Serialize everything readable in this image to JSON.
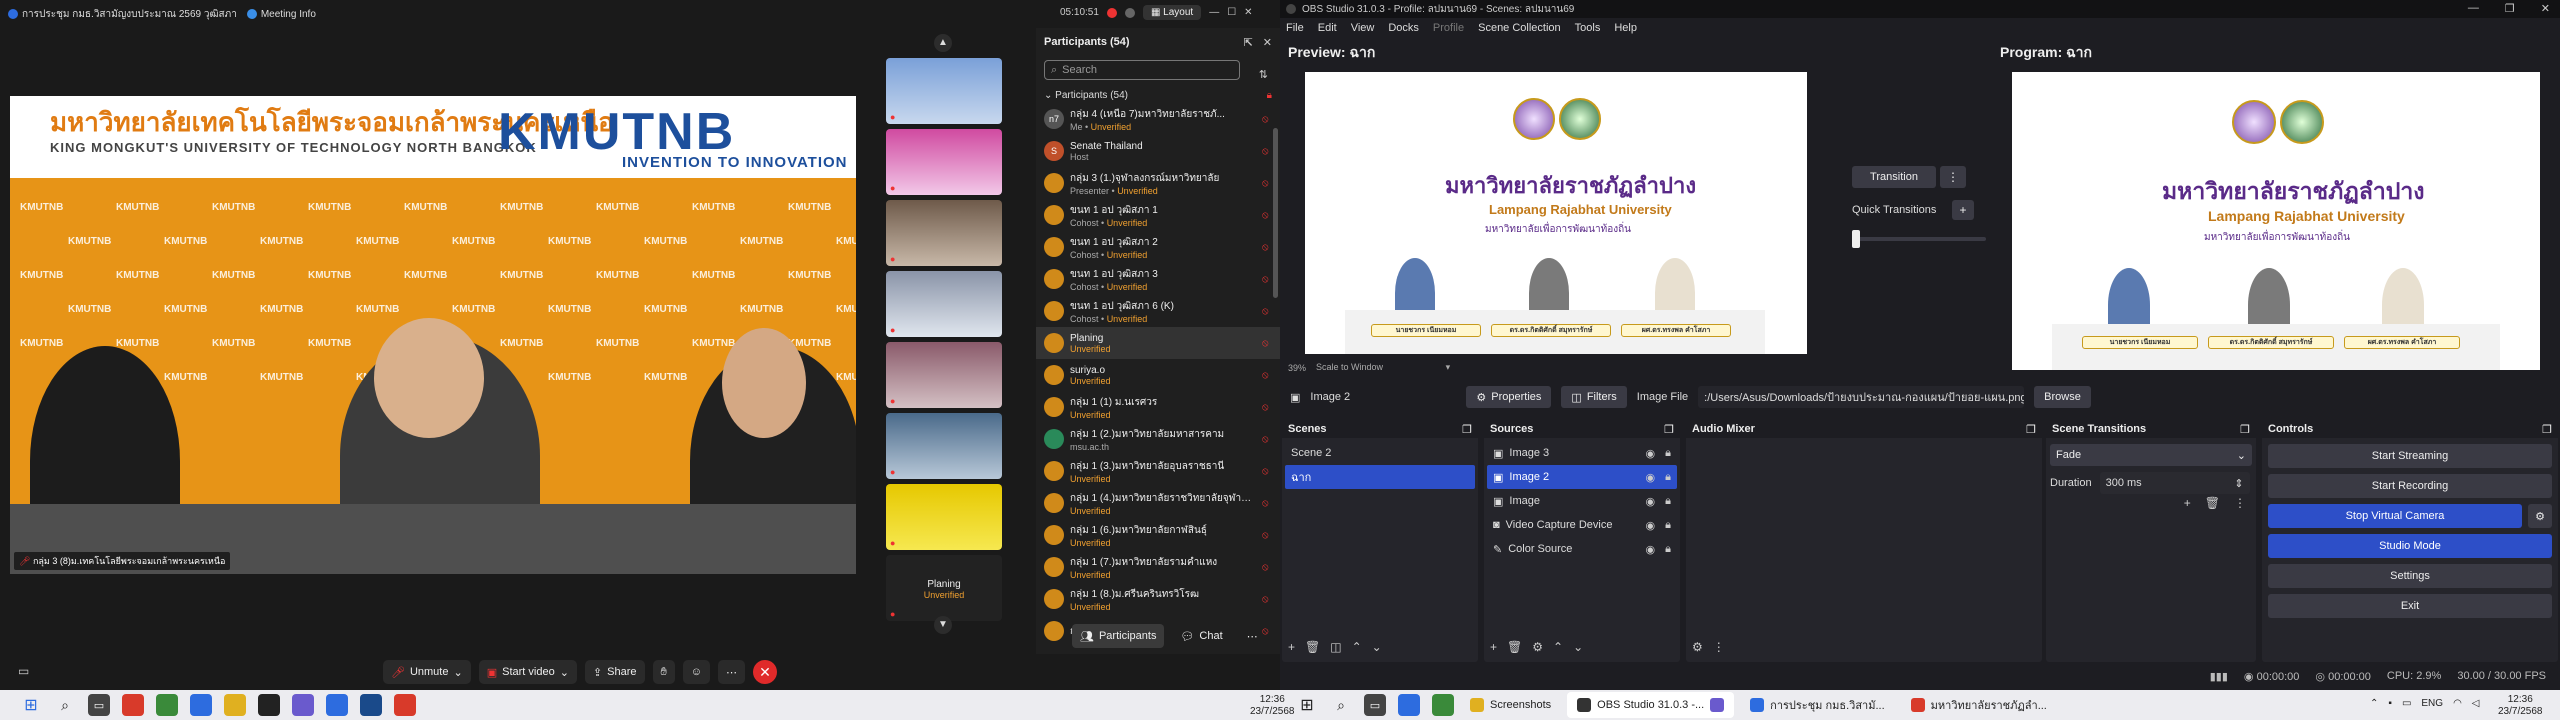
{
  "zoom": {
    "window_title": "การประชุม กมธ.วิสามัญงบประมาณ 2569 วุฒิสภา",
    "meeting_info": "Meeting Info",
    "timer": "05:10:51",
    "layout": "Layout",
    "speaker_label": "กลุ่ม 3 (8)ม.เทคโนโลยีพระจอมเกล้าพระนครเหนือ",
    "speaker_banner": {
      "thai": "มหาวิทยาลัยเทคโนโลยีพระจอมเกล้าพระนครเหนือ",
      "english": "KING MONGKUT'S UNIVERSITY OF TECHNOLOGY NORTH BANGKOK",
      "logo": "KMUTNB",
      "tagline": "INVENTION TO INNOVATION",
      "backdrop": "KMUTNB"
    },
    "thumb_planing": "Planing",
    "thumb_unverified": "Unverified",
    "toolbar": {
      "unmute": "Unmute",
      "start_video": "Start video",
      "share": "Share"
    },
    "participants": {
      "title": "Participants (54)",
      "search_placeholder": "Search",
      "section": "Participants (54)",
      "list": [
        {
          "initials": "n7",
          "name": "กลุ่ม 4 (เหนือ 7)มหาวิทยาลัยราชภั...",
          "role": "Me",
          "unverified": "Unverified",
          "color": "#555555"
        },
        {
          "initials": "S",
          "name": "Senate Thailand",
          "role": "Host",
          "unverified": "",
          "color": "#c0502a"
        },
        {
          "initials": "",
          "name": "กลุ่ม 3 (1.)จุฬาลงกรณ์มหาวิทยาลัย",
          "role": "Presenter",
          "unverified": "Unverified",
          "color": "#d08a1a"
        },
        {
          "initials": "",
          "name": "ขนท 1 อป วุฒิสภา 1",
          "role": "Cohost",
          "unverified": "Unverified",
          "color": "#d08a1a"
        },
        {
          "initials": "",
          "name": "ขนท 1 อป วุฒิสภา 2",
          "role": "Cohost",
          "unverified": "Unverified",
          "color": "#d08a1a"
        },
        {
          "initials": "",
          "name": "ขนท 1 อป วุฒิสภา 3",
          "role": "Cohost",
          "unverified": "Unverified",
          "color": "#d08a1a"
        },
        {
          "initials": "",
          "name": "ขนท 1 อป วุฒิสภา 6 (K)",
          "role": "Cohost",
          "unverified": "Unverified",
          "color": "#d08a1a"
        },
        {
          "initials": "",
          "name": "Planing",
          "role": "",
          "unverified": "Unverified",
          "color": "#d08a1a"
        },
        {
          "initials": "",
          "name": "suriya.o",
          "role": "",
          "unverified": "Unverified",
          "color": "#d08a1a"
        },
        {
          "initials": "",
          "name": "กลุ่ม 1 (1) ม.นเรศวร",
          "role": "",
          "unverified": "Unverified",
          "color": "#d08a1a"
        },
        {
          "initials": "",
          "name": "กลุ่ม 1 (2.)มหาวิทยาลัยมหาสารคาม",
          "role": "msu.ac.th",
          "unverified": "",
          "color": "#2a8a5a"
        },
        {
          "initials": "",
          "name": "กลุ่ม 1 (3.)มหาวิทยาลัยอุบลราชธานี",
          "role": "",
          "unverified": "Unverified",
          "color": "#d08a1a"
        },
        {
          "initials": "",
          "name": "กลุ่ม 1 (4.)มหาวิทยาลัยราชวิทยาลัยจุฬาภรณ์",
          "role": "",
          "unverified": "Unverified",
          "color": "#d08a1a"
        },
        {
          "initials": "",
          "name": "กลุ่ม 1 (6.)มหาวิทยาลัยกาฬสินธุ์",
          "role": "",
          "unverified": "Unverified",
          "color": "#d08a1a"
        },
        {
          "initials": "",
          "name": "กลุ่ม 1 (7.)มหาวิทยาลัยรามคำแหง",
          "role": "",
          "unverified": "Unverified",
          "color": "#d08a1a"
        },
        {
          "initials": "",
          "name": "กลุ่ม 1 (8.)ม.ศรีนครินทรวิโรฒ",
          "role": "",
          "unverified": "Unverified",
          "color": "#d08a1a"
        },
        {
          "initials": "",
          "name": "กลุ่ม 1 (9.)ม.ปทุมวัน",
          "role": "",
          "unverified": "",
          "color": "#d08a1a"
        }
      ],
      "footer_participants": "Participants",
      "footer_chat": "Chat"
    }
  },
  "obs": {
    "window_title": "OBS Studio 31.0.3 - Profile: ลปมนาน69 - Scenes: ลปมนาน69",
    "menu": [
      "File",
      "Edit",
      "View",
      "Docks",
      "Profile",
      "Scene Collection",
      "Tools",
      "Help"
    ],
    "preview_label": "Preview: ฉาก",
    "program_label": "Program: ฉาก",
    "zoom_percent": "39%",
    "zoom_mode": "Scale to Window",
    "transition": "Transition",
    "quick_transitions": "Quick Transitions",
    "canvas": {
      "thai": "มหาวิทยาลัยราชภัฏลำปาง",
      "english": "Lampang Rajabhat University",
      "subtitle": "มหาวิทยาลัยเพื่อการพัฒนาท้องถิ่น",
      "names": [
        "นายชวกร เนียมหอม",
        "ดร.ดร.กิตติศักดิ์ สมุทรารักษ์",
        "ผศ.ดร.ทรงพล คำโสภา"
      ]
    },
    "source_toolbar": {
      "selected": "Image 2",
      "properties": "Properties",
      "filters": "Filters",
      "image_file_label": "Image File",
      "image_file_value": ":/Users/Asus/Downloads/ป้ายงบประมาณ-กองแผน/ป้ายอย-แผน.png",
      "browse": "Browse"
    },
    "scenes": {
      "title": "Scenes",
      "items": [
        "Scene 2",
        "ฉาก"
      ],
      "selected": 1
    },
    "sources": {
      "title": "Sources",
      "items": [
        "Image 3",
        "Image 2",
        "Image",
        "Video Capture Device",
        "Color Source"
      ],
      "selected": 1
    },
    "audio_mixer": {
      "title": "Audio Mixer"
    },
    "scene_transitions": {
      "title": "Scene Transitions",
      "type": "Fade",
      "duration_label": "Duration",
      "duration": "300 ms"
    },
    "controls": {
      "title": "Controls",
      "start_streaming": "Start Streaming",
      "start_recording": "Start Recording",
      "stop_virtual_camera": "Stop Virtual Camera",
      "studio_mode": "Studio Mode",
      "settings": "Settings",
      "exit": "Exit"
    },
    "status": {
      "rec_time": "00:00:00",
      "stream_time": "00:00:00",
      "cpu": "CPU: 2.9%",
      "fps": "30.00 / 30.00 FPS"
    }
  },
  "taskbar": {
    "apps": [
      {
        "label": "Screenshots",
        "color": "#e0b020"
      },
      {
        "label": "OBS Studio 31.0.3 -...",
        "color": "#333333"
      },
      {
        "label": "การประชุม กมธ.วิสามั...",
        "color": "#2d6cdf"
      },
      {
        "label": "มหาวิทยาลัยราชภัฏลำ...",
        "color": "#d83a2a"
      }
    ],
    "lang": "ENG",
    "time": "12:36",
    "date": "23/7/2568"
  },
  "colors": {
    "accent": "#2d4fc8",
    "zoom_end": "#e02a2a",
    "unverified": "#f0a030"
  }
}
